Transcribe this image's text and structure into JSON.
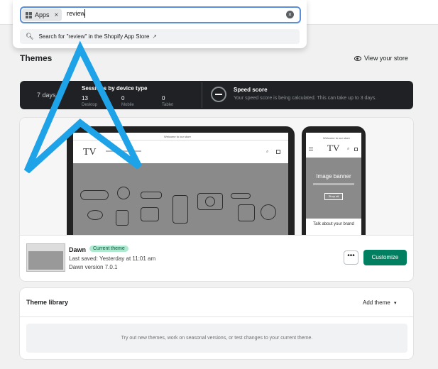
{
  "search": {
    "scope_chip": "Apps",
    "chip_remove": "×",
    "query": "review",
    "clear": "×",
    "suggestion": "Search for \"review\" in the Shopify App Store"
  },
  "header": {
    "title": "Themes",
    "view_store": "View your store"
  },
  "stats": {
    "period": "7 days",
    "sessions_title": "Sessions by device type",
    "devices": [
      {
        "value": "13",
        "label": "Desktop"
      },
      {
        "value": "0",
        "label": "Mobile"
      },
      {
        "value": "0",
        "label": "Tablet"
      }
    ],
    "speed_title": "Speed score",
    "speed_desc": "Your speed score is being calculated. This can take up to 3 days."
  },
  "preview": {
    "announcement": "Welcome to our store",
    "logo": "TV",
    "phone_banner": "Image banner",
    "phone_button": "Shop all",
    "phone_text": "Talk about your brand"
  },
  "current_theme": {
    "name": "Dawn",
    "badge": "Current theme",
    "saved": "Last saved: Yesterday at 11:01 am",
    "version": "Dawn version 7.0.1",
    "more": "•••",
    "customize": "Customize"
  },
  "library": {
    "title": "Theme library",
    "add_theme": "Add theme",
    "empty_text": "Try out new themes, work on seasonal versions, or test changes to your current theme."
  },
  "colors": {
    "accent": "#008060",
    "focus": "#5b8fd6",
    "annotation_arrow": "#1ea3e8"
  }
}
